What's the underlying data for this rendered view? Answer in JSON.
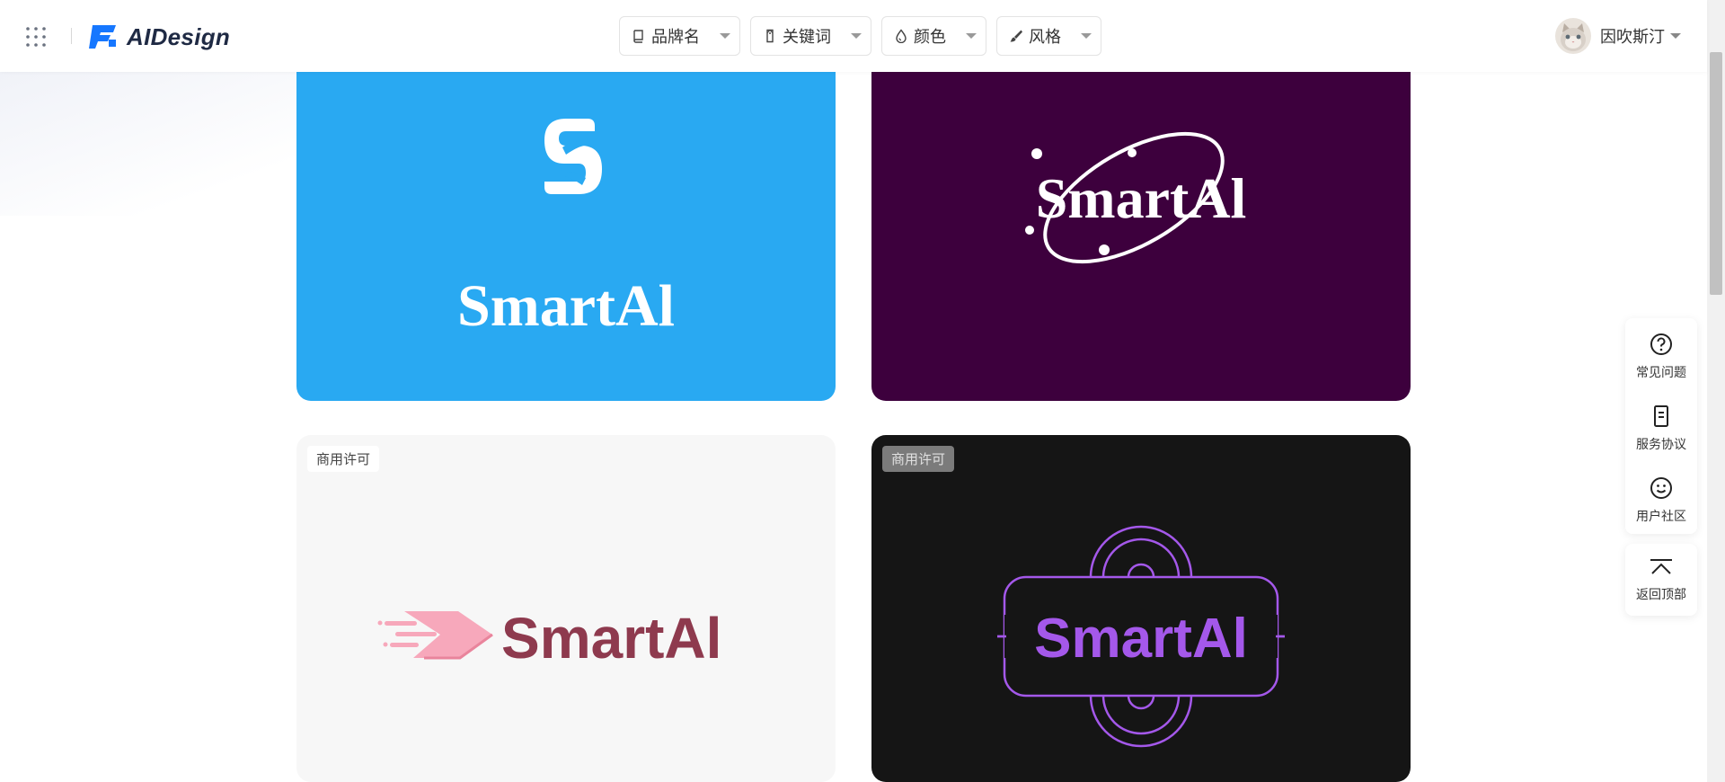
{
  "app": {
    "name": "AIDesign"
  },
  "filters": [
    {
      "label": "品牌名",
      "icon": "book-icon"
    },
    {
      "label": "关键词",
      "icon": "tag-icon"
    },
    {
      "label": "颜色",
      "icon": "drop-icon"
    },
    {
      "label": "风格",
      "icon": "brush-icon"
    }
  ],
  "user": {
    "name": "因吹斯汀"
  },
  "cards": [
    {
      "brand": "SmartAl",
      "bg": "#29a9f2",
      "badge": ""
    },
    {
      "brand": "SmartAl",
      "bg": "#3d003d",
      "badge": ""
    },
    {
      "brand": "SmartAl",
      "bg": "#f7f7f7",
      "badge": "商用许可",
      "text_color": "#8e3a4e"
    },
    {
      "brand": "SmartAl",
      "bg": "#151515",
      "badge": "商用许可",
      "text_color": "#a458ea"
    }
  ],
  "side_tools": [
    {
      "label": "常见问题",
      "icon": "help-circle-icon"
    },
    {
      "label": "服务协议",
      "icon": "document-icon"
    },
    {
      "label": "用户社区",
      "icon": "smile-icon"
    }
  ],
  "back_to_top": {
    "label": "返回顶部",
    "icon": "arrow-up-icon"
  },
  "colors": {
    "accent": "#1677ff",
    "logo_dark": "#1f2a44"
  }
}
